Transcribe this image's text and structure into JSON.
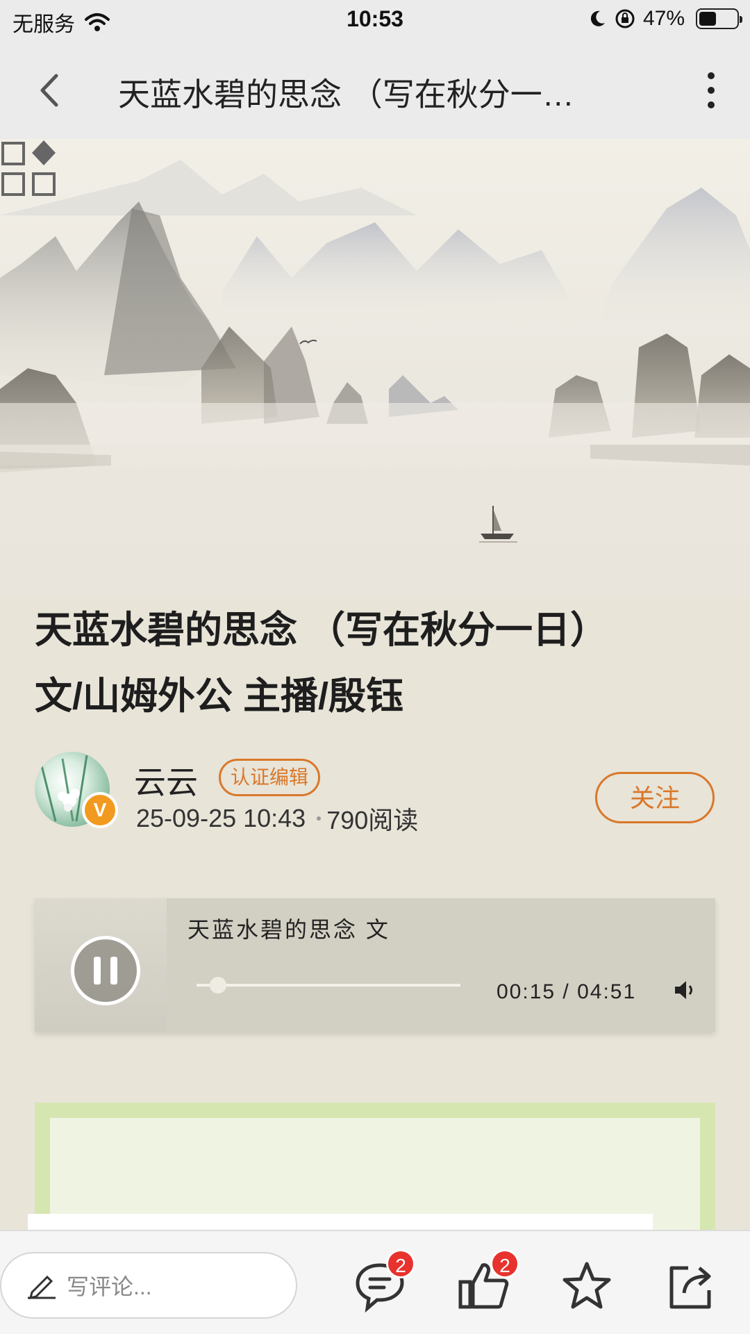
{
  "status_bar": {
    "carrier": "无服务",
    "time": "10:53",
    "battery": "47%",
    "battery_level": 0.47
  },
  "nav": {
    "title": "天蓝水碧的思念 （写在秋分一…"
  },
  "article": {
    "title_line1": "天蓝水碧的思念 （写在秋分一日）",
    "title_line2": "文/山姆外公 主播/殷钰"
  },
  "author": {
    "name": "云云",
    "tag": "认证编辑",
    "badge": "V",
    "date": "25-09-25 10:43",
    "reads": "790阅读",
    "follow_label": "关注"
  },
  "player": {
    "track_title": "天蓝水碧的思念 文",
    "time": "00:15 / 04:51",
    "progress": 0.05
  },
  "bottom_bar": {
    "comment_placeholder": "写评论...",
    "comment_count": "2",
    "like_count": "2"
  },
  "colors": {
    "accent": "#d9782a",
    "badge_red": "#e8322d",
    "page_bg": "#e8e4d8"
  }
}
